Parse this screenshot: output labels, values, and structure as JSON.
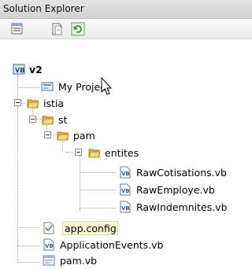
{
  "window": {
    "title": "Solution Explorer"
  },
  "toolbar": {
    "buttons": [
      {
        "icon": "properties-icon"
      },
      {
        "icon": "show-all-files-icon"
      },
      {
        "icon": "refresh-icon"
      }
    ]
  },
  "tree": {
    "project": "v2",
    "items": {
      "my_project": "My Project",
      "istia": "istia",
      "st": "st",
      "pam": "pam",
      "entites": "entites",
      "raw_cotisations": "RawCotisations.vb",
      "raw_employe": "RawEmploye.vb",
      "raw_indemnites": "RawIndemnites.vb",
      "app_config": "app.config",
      "application_events": "ApplicationEvents.vb",
      "pam_vb": "pam.vb"
    }
  },
  "colors": {
    "selection_highlight": "#fdf6d2",
    "folder": "#f3c64a",
    "vb_file": "#2f5fa8"
  }
}
